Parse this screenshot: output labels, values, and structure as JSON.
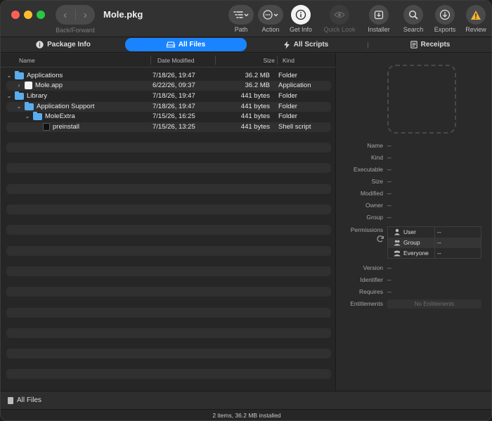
{
  "window": {
    "title": "Mole.pkg"
  },
  "toolbar": {
    "nav_label": "Back/Forward",
    "buttons": [
      {
        "label": "Path",
        "icon": "path-icon"
      },
      {
        "label": "Action",
        "icon": "action-icon"
      },
      {
        "label": "Get Info",
        "icon": "info-icon"
      },
      {
        "label": "Quick Look",
        "icon": "eye-icon"
      },
      {
        "label": "Installer",
        "icon": "installer-icon"
      },
      {
        "label": "Search",
        "icon": "search-icon"
      },
      {
        "label": "Exports",
        "icon": "export-icon"
      },
      {
        "label": "Review",
        "icon": "warning-icon"
      }
    ]
  },
  "tabs": [
    {
      "label": "Package Info",
      "icon": "info-icon",
      "active": false
    },
    {
      "label": "All Files",
      "icon": "drive-icon",
      "active": true
    },
    {
      "label": "All Scripts",
      "icon": "script-icon",
      "active": false
    },
    {
      "label": "Receipts",
      "icon": "receipt-icon",
      "active": false
    }
  ],
  "columns": {
    "name": "Name",
    "date": "Date Modified",
    "size": "Size",
    "kind": "Kind"
  },
  "files": [
    {
      "name": "Applications",
      "date": "7/18/26, 19:47",
      "size": "36.2 MB",
      "kind": "Folder"
    },
    {
      "name": "Mole.app",
      "date": "6/22/26, 09:37",
      "size": "36.2 MB",
      "kind": "Application"
    },
    {
      "name": "Library",
      "date": "7/18/26, 19:47",
      "size": "441 bytes",
      "kind": "Folder"
    },
    {
      "name": "Application Support",
      "date": "7/18/26, 19:47",
      "size": "441 bytes",
      "kind": "Folder"
    },
    {
      "name": "MoleExtra",
      "date": "7/15/26, 16:25",
      "size": "441 bytes",
      "kind": "Folder"
    },
    {
      "name": "preinstall",
      "date": "7/15/26, 13:25",
      "size": "441 bytes",
      "kind": "Shell script"
    }
  ],
  "info": {
    "fields": [
      {
        "key": "Name",
        "value": "--"
      },
      {
        "key": "Kind",
        "value": "--"
      },
      {
        "key": "Executable",
        "value": "--"
      },
      {
        "key": "Size",
        "value": "--"
      },
      {
        "key": "Modified",
        "value": "--"
      },
      {
        "key": "Owner",
        "value": "--"
      },
      {
        "key": "Group",
        "value": "--"
      }
    ],
    "permissions_label": "Permissions",
    "permissions": [
      {
        "who": "User",
        "value": "--"
      },
      {
        "who": "Group",
        "value": "--"
      },
      {
        "who": "Everyone",
        "value": "--"
      }
    ],
    "fields2": [
      {
        "key": "Version",
        "value": "--"
      },
      {
        "key": "Identifier",
        "value": "--"
      },
      {
        "key": "Requires",
        "value": "--"
      }
    ],
    "entitlements_label": "Entitlements",
    "entitlements_button": "No Entitlements"
  },
  "bottom": {
    "label": "All Files"
  },
  "status": {
    "text": "2 items, 36.2 MB installed"
  }
}
